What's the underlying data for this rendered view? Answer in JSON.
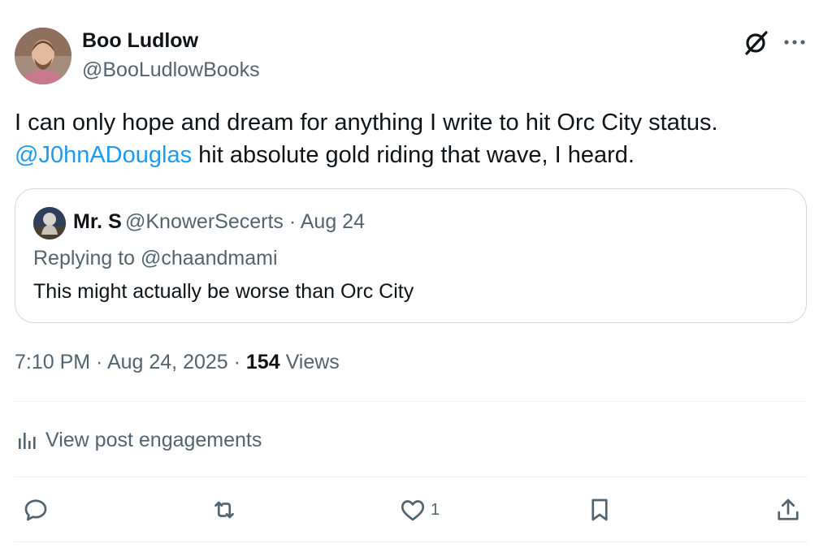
{
  "author": {
    "name": "Boo Ludlow",
    "handle": "@BooLudlowBooks",
    "avatar_icon": "avatar-photo"
  },
  "header_icons": [
    "grok-icon",
    "more-icon"
  ],
  "tweet": {
    "line1": "I can only hope and dream for anything I write to hit Orc City status.",
    "mention": "@J0hnADouglas",
    "line2_rest": " hit absolute gold riding that wave, I heard."
  },
  "quote": {
    "name": "Mr. S",
    "handle_line": "@KnowerSecerts · Aug 24",
    "replying_to": "Replying to @chaandmami",
    "text": "This might actually be worse than Orc City"
  },
  "meta": {
    "time": "7:10 PM · Aug 24, 2025 · ",
    "views_count": "154",
    "views_label": " Views"
  },
  "engagements_label": "View post engagements",
  "actions": {
    "reply_icon": "reply-icon",
    "repost_icon": "repost-icon",
    "like_icon": "heart-icon",
    "like_count": "1",
    "bookmark_icon": "bookmark-icon",
    "share_icon": "share-icon"
  },
  "colors": {
    "text": "#0f1419",
    "secondary": "#536471",
    "link": "#1d9bf0",
    "border": "#cfd9de"
  }
}
